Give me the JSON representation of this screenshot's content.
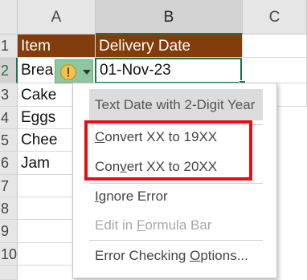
{
  "columns": [
    "A",
    "B",
    "C"
  ],
  "rows": [
    "1",
    "2",
    "3",
    "4",
    "5",
    "6",
    "7",
    "8",
    "9",
    "10"
  ],
  "header_row": {
    "item": "Item",
    "delivery_date": "Delivery Date"
  },
  "items": [
    "Brea",
    "Cake",
    "Eggs",
    "Chee",
    "Jam"
  ],
  "active_cell_value": "01-Nov-23",
  "colors": {
    "header_fill": "#833c0b",
    "selection": "#217346",
    "highlight_box": "#e0101a",
    "smart_tag": "#8cc7a0"
  },
  "error_menu": {
    "title": "Text Date with 2-Digit Year",
    "convert_19": {
      "pre": "",
      "key": "C",
      "post": "onvert XX to 19XX"
    },
    "convert_20": {
      "pre": "Con",
      "key": "v",
      "post": "ert XX to 20XX"
    },
    "ignore": {
      "pre": "",
      "key": "I",
      "post": "gnore Error"
    },
    "edit_formula": {
      "pre": "Edit in ",
      "key": "F",
      "post": "ormula Bar"
    },
    "options": {
      "pre": "Error Checking ",
      "key": "O",
      "post": "ptions..."
    }
  },
  "icons": {
    "warning": "warning-icon",
    "dropdown": "chevron-down-icon"
  }
}
